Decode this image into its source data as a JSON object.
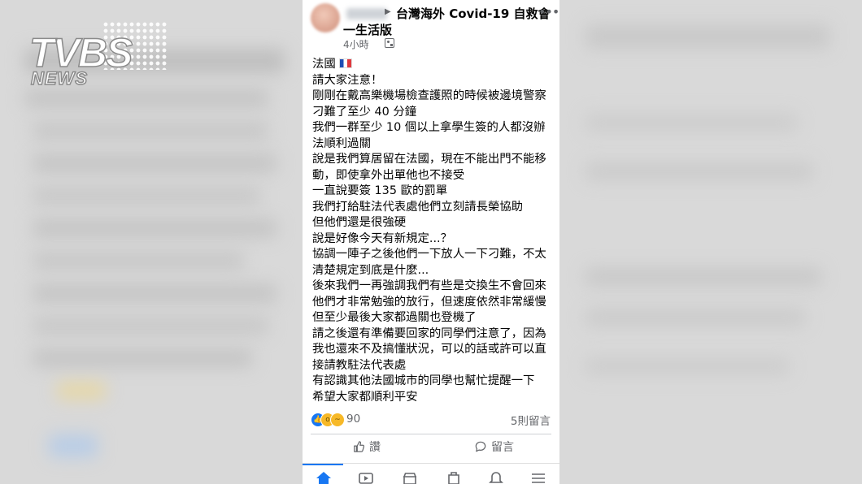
{
  "post": {
    "group_name_line1": "台灣海外 Covid-19 自救會",
    "group_name_line2": "一生活版",
    "timestamp": "4小時",
    "body_lines": [
      "法國",
      "請大家注意！",
      "剛剛在戴高樂機場檢查護照的時候被邊境警察",
      "刁難了至少 40 分鐘",
      "我們一群至少 10 個以上拿學生簽的人都沒辦",
      "法順利過關",
      "說是我們算居留在法國，現在不能出門不能移",
      "動，即使拿外出單他也不接受",
      "一直說要簽 135 歐的罰單",
      "我們打給駐法代表處他們立刻請長榮協助",
      "但他們還是很強硬",
      "說是好像今天有新規定...？",
      "協調一陣子之後他們一下放人一下刁難，不太",
      "清楚規定到底是什麼...",
      "後來我們一再強調我們有些是交換生不會回來",
      "他們才非常勉強的放行，但速度依然非常緩慢",
      "但至少最後大家都過關也登機了",
      "請之後還有準備要回家的同學們注意了，因為",
      "我也還來不及搞懂狀況，可以的話或許可以直",
      "接請教駐法代表處",
      "有認識其他法國城市的同學也幫忙提醒一下",
      "希望大家都順利平安"
    ],
    "flag_icon": "france-flag-icon",
    "reaction_count": "90",
    "reactions": [
      "like-icon",
      "wow-icon",
      "sad-icon"
    ],
    "comment_count": "5則留言",
    "like_label": "讚",
    "comment_label": "留言"
  },
  "nav": [
    "home-icon",
    "video-icon",
    "marketplace-icon",
    "groups-icon",
    "notifications-icon",
    "menu-icon"
  ],
  "logo": {
    "line1": "TVBS",
    "line2": "NEWS"
  },
  "colors": {
    "accent": "#1877f2",
    "text": "#050505",
    "secondary": "#65676b",
    "background": "#d9d9d9"
  }
}
